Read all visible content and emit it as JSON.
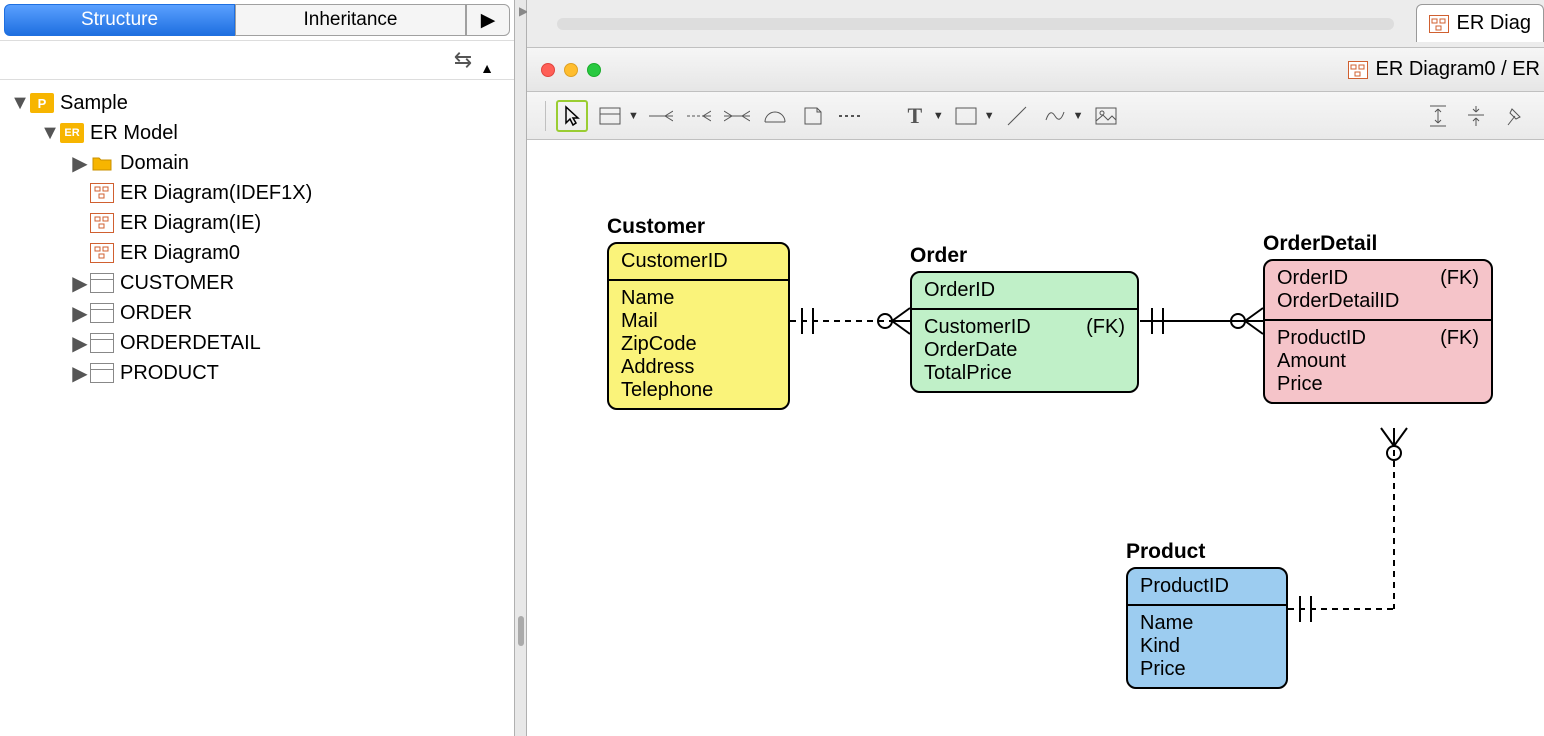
{
  "tabs": {
    "structure": "Structure",
    "inheritance": "Inheritance"
  },
  "tree": {
    "root": "Sample",
    "model": "ER Model",
    "domain": "Domain",
    "diag_idef1x": "ER Diagram(IDEF1X)",
    "diag_ie": "ER Diagram(IE)",
    "diag0": "ER Diagram0",
    "t_customer": "CUSTOMER",
    "t_order": "ORDER",
    "t_orderdetail": "ORDERDETAIL",
    "t_product": "PRODUCT"
  },
  "topTab": "ER Diag",
  "windowTitle": "ER Diagram0 / ER",
  "entities": {
    "customer": {
      "title": "Customer",
      "pk": [
        "CustomerID"
      ],
      "attrs": [
        "Name",
        "Mail",
        "ZipCode",
        "Address",
        "Telephone"
      ]
    },
    "order": {
      "title": "Order",
      "pk": [
        "OrderID"
      ],
      "attrs": [
        {
          "name": "CustomerID",
          "fk": "(FK)"
        },
        {
          "name": "OrderDate"
        },
        {
          "name": "TotalPrice"
        }
      ]
    },
    "orderDetail": {
      "title": "OrderDetail",
      "pk": [
        {
          "name": "OrderID",
          "fk": "(FK)"
        },
        {
          "name": "OrderDetailID"
        }
      ],
      "attrs": [
        {
          "name": "ProductID",
          "fk": "(FK)"
        },
        {
          "name": "Amount"
        },
        {
          "name": "Price"
        }
      ]
    },
    "product": {
      "title": "Product",
      "pk": [
        "ProductID"
      ],
      "attrs": [
        "Name",
        "Kind",
        "Price"
      ]
    }
  },
  "fkLabel": "(FK)"
}
